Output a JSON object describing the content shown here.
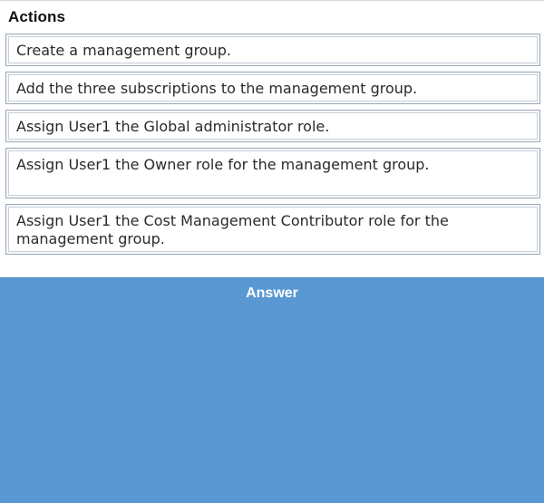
{
  "actions": {
    "title": "Actions",
    "items": [
      "Create a management group.",
      "Add the three subscriptions to the management group.",
      "Assign User1 the Global administrator role.",
      "Assign User1 the Owner role for the management group.",
      "Assign User1 the Cost Management Contributor role for the management group."
    ]
  },
  "answer": {
    "title": "Answer"
  },
  "colors": {
    "answer_background": "#5a98d3",
    "item_border": "#9aa8b8"
  }
}
